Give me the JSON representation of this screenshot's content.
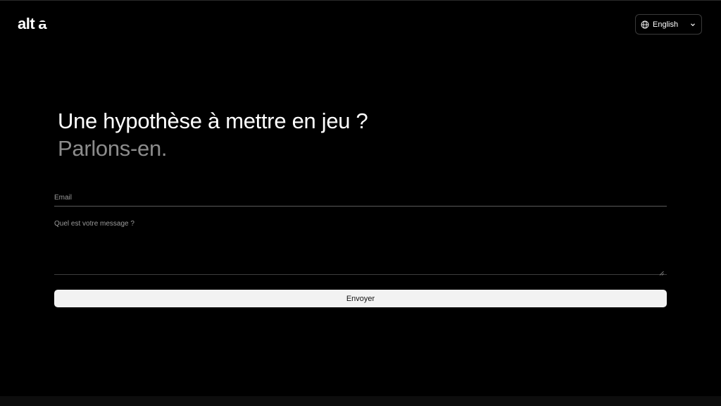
{
  "header": {
    "logo": {
      "word": "alt",
      "mark": "a"
    },
    "language_selector": {
      "icon": "globe-icon",
      "selected": "English",
      "chevron_icon": "chevron-down-icon"
    }
  },
  "hero": {
    "title_line1": "Une hypothèse à mettre en jeu ?",
    "title_line2": "Parlons-en."
  },
  "form": {
    "email_placeholder": "Email",
    "email_value": "",
    "message_placeholder": "Quel est votre message ?",
    "message_value": "",
    "submit_label": "Envoyer"
  },
  "colors": {
    "background": "#000000",
    "text_primary": "#ffffff",
    "text_muted": "#8c8c8c",
    "button_background": "#f2f2f2",
    "button_text": "#111111"
  }
}
